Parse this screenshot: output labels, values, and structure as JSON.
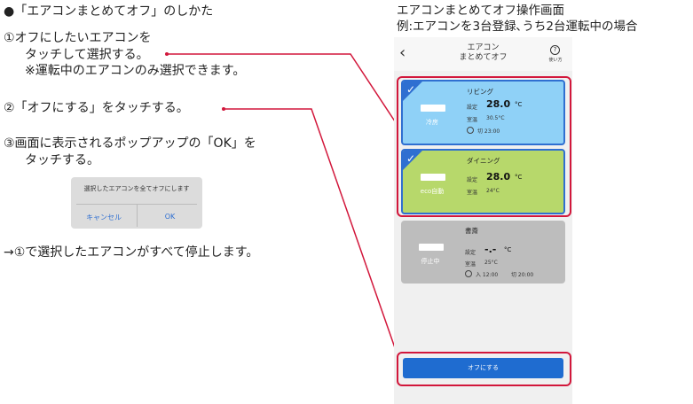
{
  "instructions": {
    "heading": "●「エアコンまとめてオフ」のしかた",
    "step1_line1": "①オフにしたいエアコンを",
    "step1_line2": "タッチして選択する。",
    "step1_note": "※運転中のエアコンのみ選択できます。",
    "step2": "②「オフにする」をタッチする。",
    "step3_line1": "③画面に表示されるポップアップの「OK」を",
    "step3_line2": "タッチする。",
    "result": "→①で選択したエアコンがすべて停止します。"
  },
  "popup": {
    "message": "選択したエアコンを全てオフにします",
    "cancel": "キャンセル",
    "ok": "OK"
  },
  "screen_caption": {
    "line1": "エアコンまとめてオフ操作画面",
    "line2": "例:エアコンを3台登録､うち2台運転中の場合"
  },
  "phone": {
    "back_glyph": "‹",
    "title_line1": "エアコン",
    "title_line2": "まとめてオフ",
    "help_glyph": "?",
    "help_label": "使い方",
    "cards": [
      {
        "room": "リビング",
        "mode": "冷房",
        "set_label": "設定",
        "set_value": "28.0",
        "unit": "°C",
        "room_label": "室温",
        "room_temp": "30.5°C",
        "timer": "切 23:00",
        "color": "#8fd1f7",
        "selected": true
      },
      {
        "room": "ダイニング",
        "mode": "eco自動",
        "set_label": "設定",
        "set_value": "28.0",
        "unit": "°C",
        "room_label": "室温",
        "room_temp": "24°C",
        "color": "#b7d86b",
        "selected": true
      },
      {
        "room": "書斎",
        "mode": "停止中",
        "set_label": "設定",
        "set_value": "-.-",
        "unit": "°C",
        "room_label": "室温",
        "room_temp": "25°C",
        "timer_on": "入 12:00",
        "timer_off": "切 20:00",
        "color": "#bdbdbd",
        "selected": false
      }
    ],
    "off_button": "オフにする"
  },
  "colors": {
    "highlight": "#d2173b",
    "accent": "#2f6fd1",
    "button": "#1f6cd0"
  }
}
